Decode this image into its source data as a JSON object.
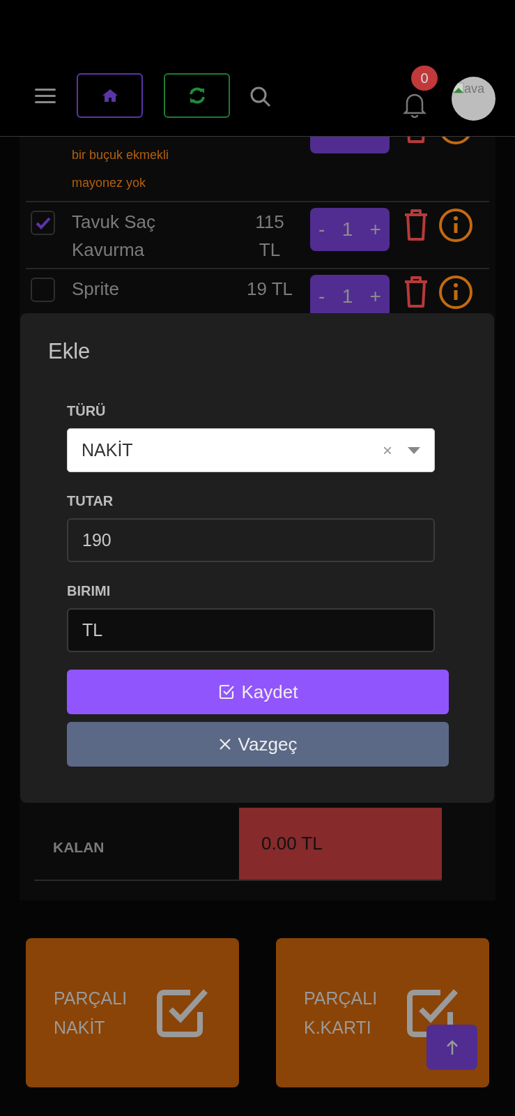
{
  "header": {
    "notification_count": "0",
    "avatar_alt": "ava"
  },
  "items": [
    {
      "notes": [
        "bir buçuk ekmekli",
        "mayonez yok"
      ]
    },
    {
      "name": "Tavuk Saç Kavurma",
      "price": "115 TL",
      "checked": true,
      "quantity": "1"
    },
    {
      "name": "Sprite",
      "price": "19 TL",
      "checked": false,
      "quantity": "1"
    }
  ],
  "stepper": {
    "minus": "-",
    "plus": "+"
  },
  "summary": {
    "label": "KALAN",
    "value": "0.00 TL"
  },
  "actions": [
    {
      "label": "PARÇALI NAKİT"
    },
    {
      "label": "PARÇALI K.KARTI"
    }
  ],
  "modal": {
    "title": "Ekle",
    "fields": [
      {
        "kind": "select",
        "label": "TÜRÜ",
        "value": "NAKİT",
        "clear": "×"
      },
      {
        "kind": "input",
        "label": "TUTAR",
        "value": "190",
        "readonly": false
      },
      {
        "kind": "input",
        "label": "BIRIMI",
        "value": "TL",
        "readonly": true
      }
    ],
    "buttons": [
      {
        "kind": "primary",
        "label": "Kaydet"
      },
      {
        "kind": "secondary",
        "label": "Vazgeç"
      }
    ]
  }
}
